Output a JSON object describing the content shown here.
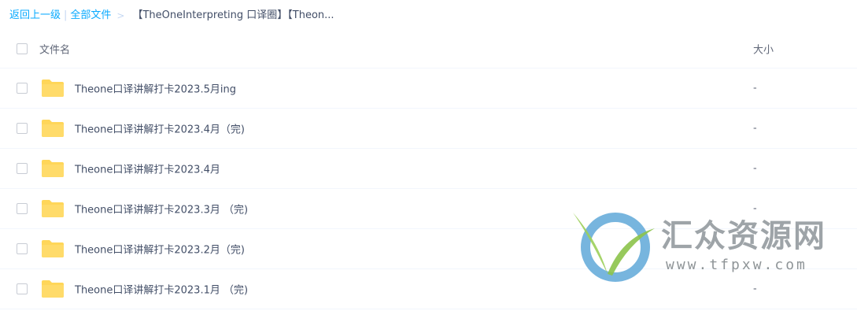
{
  "breadcrumb": {
    "back_label": "返回上一级",
    "separator_bar": "|",
    "all_files_label": "全部文件",
    "separator_arrow": ">",
    "current_path": "【TheOneInterpreting 口译圈】【Theon..."
  },
  "list": {
    "header": {
      "name_label": "文件名",
      "size_label": "大小"
    },
    "rows": [
      {
        "name": "Theone口译讲解打卡2023.5月ing",
        "size": "-",
        "icon": "folder-icon"
      },
      {
        "name": "Theone口译讲解打卡2023.4月（完)",
        "size": "-",
        "icon": "folder-icon"
      },
      {
        "name": "Theone口译讲解打卡2023.4月",
        "size": "-",
        "icon": "folder-icon"
      },
      {
        "name": "Theone口译讲解打卡2023.3月 （完)",
        "size": "-",
        "icon": "folder-icon"
      },
      {
        "name": "Theone口译讲解打卡2023.2月（完)",
        "size": "-",
        "icon": "folder-icon"
      },
      {
        "name": "Theone口译讲解打卡2023.1月 （完)",
        "size": "-",
        "icon": "folder-icon"
      }
    ]
  },
  "watermark": {
    "title": "汇众资源网",
    "url": "www.tfpxw.com"
  },
  "colors": {
    "link": "#09aaff",
    "text": "#424e67",
    "folder": "#ffd659",
    "row_divider": "#f2f6fd"
  }
}
